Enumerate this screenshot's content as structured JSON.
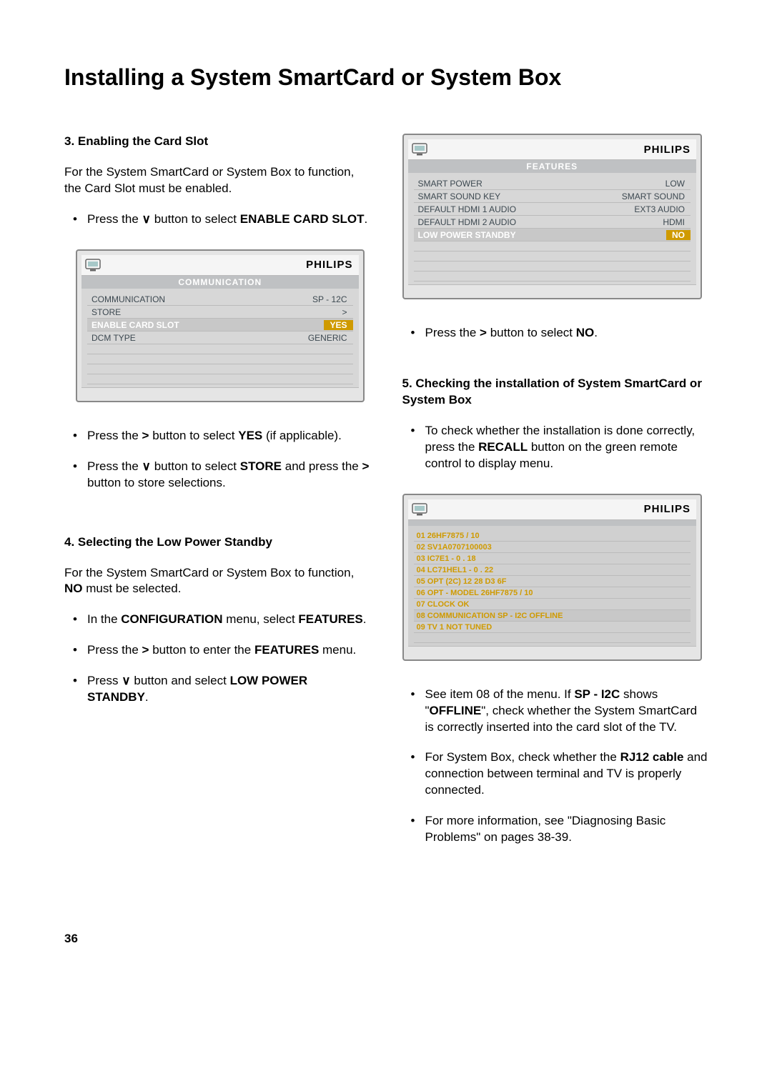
{
  "page_title": "Installing a System SmartCard or System Box",
  "page_number": "36",
  "glyphs": {
    "down": "∨",
    "right": ">"
  },
  "sec3": {
    "heading": "3.  Enabling the Card Slot",
    "intro": "For the System SmartCard or System Box to function, the Card Slot must be enabled.",
    "li1_a": "Press the ",
    "li1_b": " button to select ",
    "li1_bold": "ENABLE CARD SLOT",
    "li1_end": ".",
    "osd": {
      "brand": "PHILIPS",
      "title": "COMMUNICATION",
      "rows": [
        {
          "label": "COMMUNICATION",
          "value": "SP - 12C",
          "highlight": false
        },
        {
          "label": "STORE",
          "value": ">",
          "highlight": false
        },
        {
          "label": "ENABLE CARD SLOT",
          "value": "YES",
          "highlight": true
        },
        {
          "label": "DCM TYPE",
          "value": "GENERIC",
          "highlight": false
        }
      ],
      "blank_rows": 4
    },
    "li2_a": "Press the ",
    "li2_b": " button to select ",
    "li2_bold": "YES",
    "li2_end": " (if applicable).",
    "li3_a": "Press the ",
    "li3_b": " button to select ",
    "li3_bold": "STORE",
    "li3_c": " and press the ",
    "li3_d": " button to store selections."
  },
  "sec4": {
    "heading": "4.  Selecting the Low Power Standby",
    "intro": "For the System SmartCard or System Box to function, ",
    "intro_bold": "NO",
    "intro_end": " must be selected.",
    "li1_a": "In the ",
    "li1_bold1": "CONFIGURATION",
    "li1_b": " menu, select ",
    "li1_bold2": "FEATURES",
    "li1_end": ".",
    "li2_a": "Press the ",
    "li2_b": " button to enter the ",
    "li2_bold": "FEATURES",
    "li2_end": " menu.",
    "li3_a": "Press ",
    "li3_b": " button and select ",
    "li3_bold": "LOW POWER STANDBY",
    "li3_end": "."
  },
  "osd_features": {
    "brand": "PHILIPS",
    "title": "FEATURES",
    "rows": [
      {
        "label": "SMART POWER",
        "value": "LOW",
        "highlight": false
      },
      {
        "label": "SMART SOUND KEY",
        "value": "SMART SOUND",
        "highlight": false
      },
      {
        "label": "DEFAULT HDMI 1 AUDIO",
        "value": "EXT3 AUDIO",
        "highlight": false
      },
      {
        "label": "DEFAULT HDMI 2 AUDIO",
        "value": "HDMI",
        "highlight": false
      },
      {
        "label": "LOW POWER STANDBY",
        "value": "NO",
        "highlight": true
      }
    ],
    "blank_rows": 4
  },
  "li_no_a": "Press the ",
  "li_no_b": " button to select ",
  "li_no_bold": "NO",
  "li_no_end": ".",
  "sec5": {
    "heading": "5.  Checking the installation of System SmartCard or System Box",
    "li1_a": "To check whether the installation is done correctly, press the ",
    "li1_bold": "RECALL",
    "li1_b": " button on the green remote control to display menu.",
    "osd": {
      "brand": "PHILIPS",
      "lines": [
        "01 26HF7875 / 10",
        "02 SV1A0707100003",
        "03 IC7E1 - 0 . 18",
        "04 LC71HEL1 - 0 . 22",
        "05 OPT (2C) 12  28  D3  6F",
        "06 OPT - MODEL  26HF7875 / 10",
        "07 CLOCK  OK",
        "08 COMMUNICATION SP - I2C   OFFLINE",
        "09 TV 1 NOT TUNED"
      ],
      "selected_index": 7,
      "blank_rows": 1
    },
    "li2_a": "See item 08 of the menu. If ",
    "li2_bold1": "SP - I2C",
    "li2_b": " shows \"",
    "li2_bold2": "OFFLINE",
    "li2_c": "\", check whether the System SmartCard is correctly inserted into the card slot of the TV.",
    "li3_a": "For System Box, check whether the ",
    "li3_bold": "RJ12 cable",
    "li3_b": " and connection between terminal and TV is properly connected.",
    "li4": "For more information, see \"Diagnosing Basic Problems\" on pages 38-39."
  }
}
